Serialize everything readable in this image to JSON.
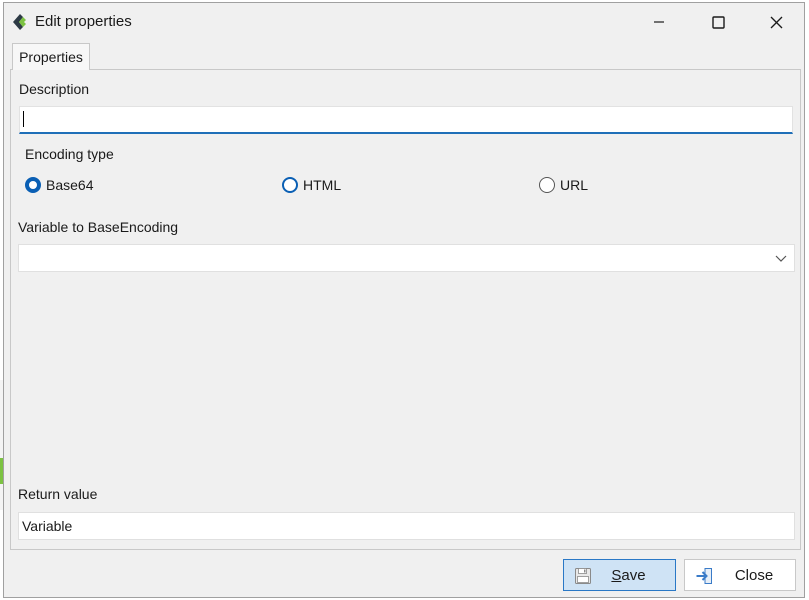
{
  "window": {
    "title": "Edit properties"
  },
  "tabs": [
    {
      "label": "Properties",
      "active": true
    }
  ],
  "description": {
    "label": "Description",
    "value": ""
  },
  "encoding": {
    "label": "Encoding type",
    "options": [
      {
        "label": "Base64",
        "checked": true
      },
      {
        "label": "HTML",
        "checked": false
      },
      {
        "label": "URL",
        "checked": false
      }
    ]
  },
  "variable": {
    "label": "Variable to BaseEncoding",
    "value": ""
  },
  "return_value": {
    "label": "Return value",
    "value": "Variable"
  },
  "buttons": {
    "save_label": "Save",
    "close_label": "Close"
  },
  "colors": {
    "accent": "#0a5fb4",
    "save_bg": "#cfe3f5",
    "window_bg": "#f0f0f0"
  }
}
